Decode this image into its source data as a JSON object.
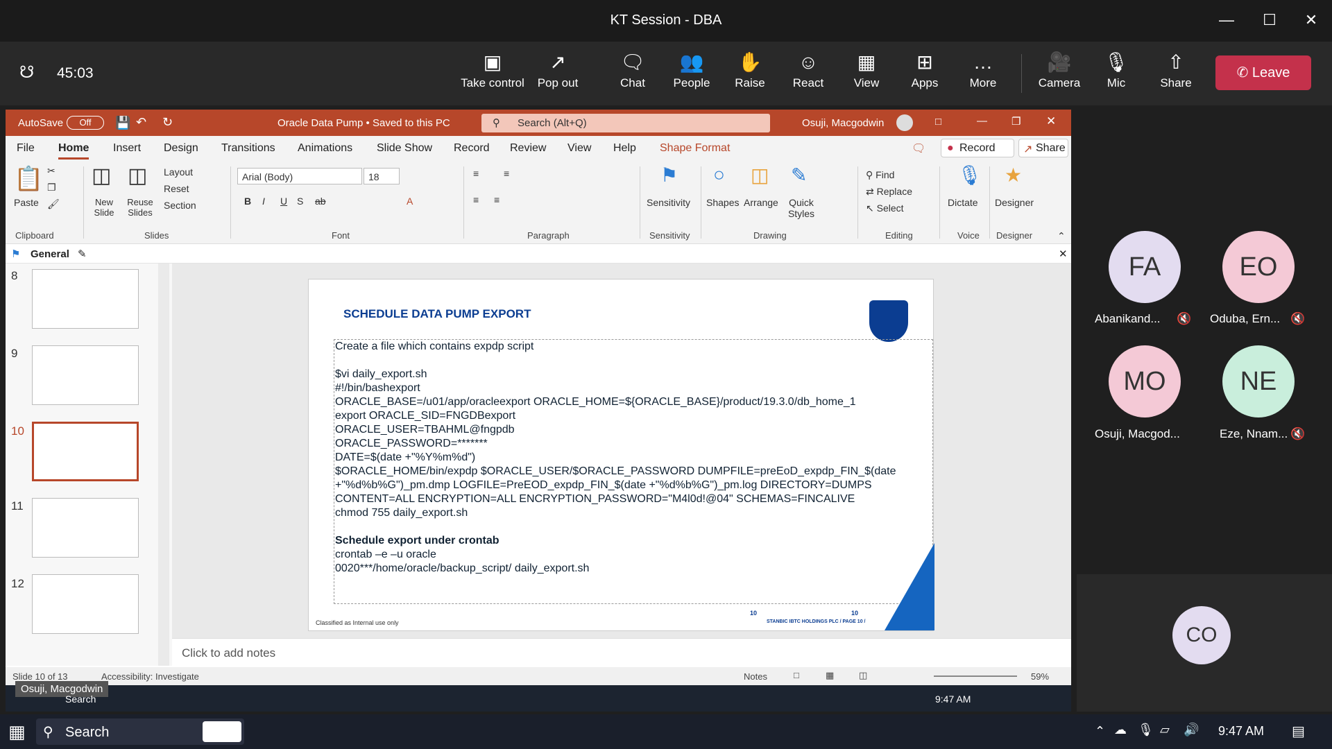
{
  "window": {
    "title": "KT Session - DBA"
  },
  "meeting": {
    "timer": "45:03",
    "toolbar": {
      "take_control": "Take control",
      "pop_out": "Pop out",
      "chat": "Chat",
      "people": "People",
      "raise": "Raise",
      "react": "React",
      "view": "View",
      "apps": "Apps",
      "more": "More",
      "camera": "Camera",
      "mic": "Mic",
      "share": "Share",
      "leave": "Leave"
    }
  },
  "ppt": {
    "autosave": "AutoSave",
    "autosave_state": "Off",
    "doc_title": "Oracle Data Pump • Saved to this PC",
    "search_placeholder": "Search (Alt+Q)",
    "user": "Osuji, Macgodwin",
    "tabs": [
      "File",
      "Home",
      "Insert",
      "Design",
      "Transitions",
      "Animations",
      "Slide Show",
      "Record",
      "Review",
      "View",
      "Help",
      "Shape Format"
    ],
    "record_btn": "Record",
    "share_btn": "Share",
    "ribbon": {
      "paste": "Paste",
      "new_slide": "New Slide",
      "reuse_slides": "Reuse Slides",
      "layout": "Layout",
      "reset": "Reset",
      "section": "Section",
      "font_name": "Arial (Body)",
      "font_size": "18",
      "sensitivity": "Sensitivity",
      "shapes": "Shapes",
      "arrange": "Arrange",
      "quick_styles": "Quick Styles",
      "find": "Find",
      "replace": "Replace",
      "select": "Select",
      "dictate": "Dictate",
      "designer": "Designer",
      "groups": [
        "Clipboard",
        "Slides",
        "Font",
        "Paragraph",
        "Sensitivity",
        "Drawing",
        "Editing",
        "Voice",
        "Designer"
      ]
    },
    "sensitivity_label": "General",
    "thumbnails": [
      "8",
      "9",
      "10",
      "11",
      "12"
    ],
    "slide": {
      "heading": "SCHEDULE DATA PUMP EXPORT",
      "lines": [
        "Create a file which contains expdp script",
        "",
        "$vi daily_export.sh",
        "#!/bin/bashexport",
        "ORACLE_BASE=/u01/app/oracleexport ORACLE_HOME=${ORACLE_BASE}/product/19.3.0/db_home_1",
        "export ORACLE_SID=FNGDBexport",
        "ORACLE_USER=TBAHML@fngpdb",
        "ORACLE_PASSWORD=*******",
        "DATE=$(date +\"%Y%m%d\")",
        "$ORACLE_HOME/bin/expdp $ORACLE_USER/$ORACLE_PASSWORD DUMPFILE=preEoD_expdp_FIN_$(date",
        "+\"%d%b%G\")_pm.dmp LOGFILE=PreEOD_expdp_FIN_$(date +\"%d%b%G\")_pm.log DIRECTORY=DUMPS",
        "CONTENT=ALL ENCRYPTION=ALL ENCRYPTION_PASSWORD=\"M4l0d!@04\" SCHEMAS=FINCALIVE",
        "chmod 755 daily_export.sh",
        ""
      ],
      "subheading": "Schedule export under crontab",
      "lines2": [
        "crontab –e –u oracle",
        "0020***/home/oracle/backup_script/ daily_export.sh"
      ],
      "footer_left": "Classified as Internal use only",
      "footer_num1": "10",
      "footer_num2": "10",
      "footer_right": "STANBIC IBTC HOLDINGS PLC / PAGE 10 /"
    },
    "notes_placeholder": "Click to add notes",
    "status": {
      "slide_count": "Slide 10 of 13",
      "accessibility": "Accessibility: Investigate",
      "notes": "Notes",
      "zoom": "59%"
    },
    "presenter": "Osuji, Macgodwin",
    "inner_search": "Search",
    "inner_time": "9:47 AM"
  },
  "participants": [
    {
      "initials": "FA",
      "name": "Abanikand...",
      "color": "#e3dcf0"
    },
    {
      "initials": "EO",
      "name": "Oduba, Ern...",
      "color": "#f4c9d6"
    },
    {
      "initials": "MO",
      "name": "Osuji, Macgod...",
      "color": "#f4c9d6"
    },
    {
      "initials": "NE",
      "name": "Eze, Nnam...",
      "color": "#c9eedc"
    },
    {
      "initials": "CO",
      "name": "",
      "color": "#e3dcf0"
    }
  ],
  "taskbar": {
    "search": "Search",
    "time": "9:47 AM"
  }
}
